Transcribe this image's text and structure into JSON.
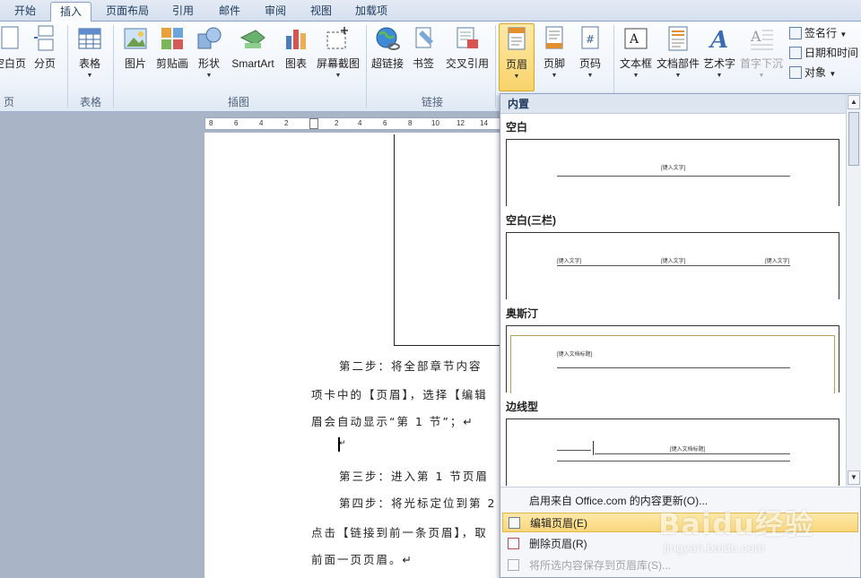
{
  "tabs": [
    "开始",
    "插入",
    "页面布局",
    "引用",
    "邮件",
    "审阅",
    "视图",
    "加载项"
  ],
  "ribbon": {
    "buttons": {
      "blank_page": "空白页",
      "page_break": "分页",
      "table": "表格",
      "picture": "图片",
      "clipart": "剪贴画",
      "shapes": "形状",
      "smartart": "SmartArt",
      "chart": "图表",
      "screenshot": "屏幕截图",
      "hyperlink": "超链接",
      "bookmark": "书签",
      "crossref": "交叉引用",
      "header": "页眉",
      "footer": "页脚",
      "page_number": "页码",
      "textbox": "文本框",
      "quickparts": "文档部件",
      "wordart": "艺术字",
      "dropcap": "首字下沉",
      "signature": "签名行",
      "datetime": "日期和时间",
      "object": "对象"
    },
    "groups": {
      "pages": "页",
      "tables": "表格",
      "illustrations": "插图",
      "links": "链接"
    }
  },
  "ruler_ticks": [
    "8",
    "6",
    "4",
    "2",
    "2",
    "4",
    "6",
    "8",
    "10",
    "12",
    "14"
  ],
  "document": {
    "lines": [
      "第二步：将全部章节内容",
      "项卡中的【页眉】，选择【编辑",
      "眉会自动显示“第 1 节”；↵",
      "↵",
      "第三步：进入第 1 节页眉",
      "第四步：将光标定位到第 2",
      "点击【链接到前一条页眉】，取",
      "前面一页页眉。↵"
    ]
  },
  "gallery": {
    "heading": "内置",
    "items": [
      {
        "name": "空白",
        "placeholder": "[键入文字]"
      },
      {
        "name": "空白(三栏)",
        "placeholder": "[键入文字]"
      },
      {
        "name": "奥斯汀",
        "placeholder": "[键入文档标题]"
      },
      {
        "name": "边线型",
        "placeholder": "[键入文档标题]"
      }
    ],
    "menu": [
      "启用来自 Office.com 的内容更新(O)...",
      "编辑页眉(E)",
      "删除页眉(R)",
      "将所选内容保存到页眉库(S)..."
    ]
  },
  "watermark": {
    "brand": "Baidu经验",
    "url": "jingyan.baidu.com"
  }
}
